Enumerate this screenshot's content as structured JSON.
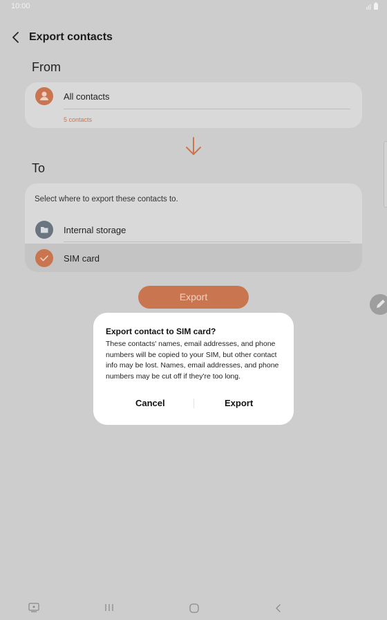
{
  "status_bar": {
    "time": "10:00"
  },
  "header": {
    "title": "Export contacts"
  },
  "from": {
    "label": "From",
    "item_label": "All contacts",
    "count": "5 contacts"
  },
  "to": {
    "label": "To",
    "prompt": "Select where to export these contacts to.",
    "options": [
      {
        "label": "Internal storage",
        "selected": false
      },
      {
        "label": "SIM card",
        "selected": true
      }
    ]
  },
  "export_button": {
    "label": "Export"
  },
  "dialog": {
    "title": "Export contact to SIM card?",
    "body": "These contacts' names, email addresses, and phone numbers will be copied to your SIM, but other contact info may be lost. Names, email addresses, and phone numbers may be cut off if they're too long.",
    "cancel_label": "Cancel",
    "confirm_label": "Export"
  },
  "colors": {
    "accent": "#c9754f",
    "folder": "#6a7580",
    "overlay": "#cdcdcd",
    "dialog_bg": "#ffffff"
  },
  "icons": [
    "user-icon",
    "folder-icon",
    "check-icon",
    "arrow-down-icon",
    "back-arrow-icon",
    "pencil-icon",
    "signal-icon",
    "battery-icon",
    "screenshot-icon",
    "recents-icon",
    "home-icon",
    "nav-back-icon"
  ]
}
